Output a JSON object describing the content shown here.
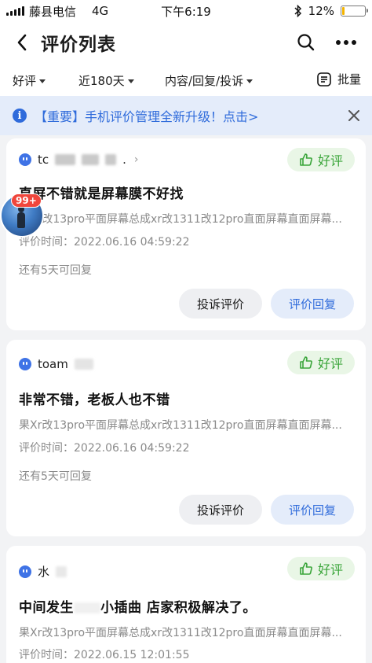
{
  "status_bar": {
    "carrier": "藤县电信",
    "network": "4G",
    "time": "下午6:19",
    "battery": "12%",
    "battery_level": 0.12
  },
  "nav": {
    "title": "评价列表"
  },
  "filters": {
    "rating": "好评",
    "period": "近180天",
    "type": "内容/回复/投诉",
    "batch": "批量"
  },
  "notice": {
    "text": "【重要】手机评价管理全新升级！点击>"
  },
  "floating_badge": {
    "count": "99+"
  },
  "reviews": [
    {
      "user": "tc",
      "user_suffix": ".",
      "badge": "好评",
      "content": "直屏不错就是屏幕膜不好找",
      "product": "果Xr改13pro平面屏幕总成xr改1311改12pro直面屏幕直面屏幕...",
      "time": "评价时间：2022.06.16 04:59:22",
      "remaining": "还有5天可回复",
      "complain_label": "投诉评价",
      "reply_label": "评价回复"
    },
    {
      "user": "toam",
      "badge": "好评",
      "content": "非常不错，老板人也不错",
      "product": "果Xr改13pro平面屏幕总成xr改1311改12pro直面屏幕直面屏幕...",
      "time": "评价时间：2022.06.16 04:59:22",
      "remaining": "还有5天可回复",
      "complain_label": "投诉评价",
      "reply_label": "评价回复"
    },
    {
      "user": "水",
      "badge": "好评",
      "content_a": "中间发生",
      "content_b": "小插曲 店家积极解决了。",
      "product": "果Xr改13pro平面屏幕总成xr改1311改12pro直面屏幕直面屏幕...",
      "time": "评价时间：2022.06.15 12:01:55"
    }
  ],
  "colors": {
    "accent_blue": "#2f6bdb",
    "good_green": "#3aa53a",
    "notice_bg": "#e4ecfa",
    "page_bg": "#f2f3f5"
  }
}
